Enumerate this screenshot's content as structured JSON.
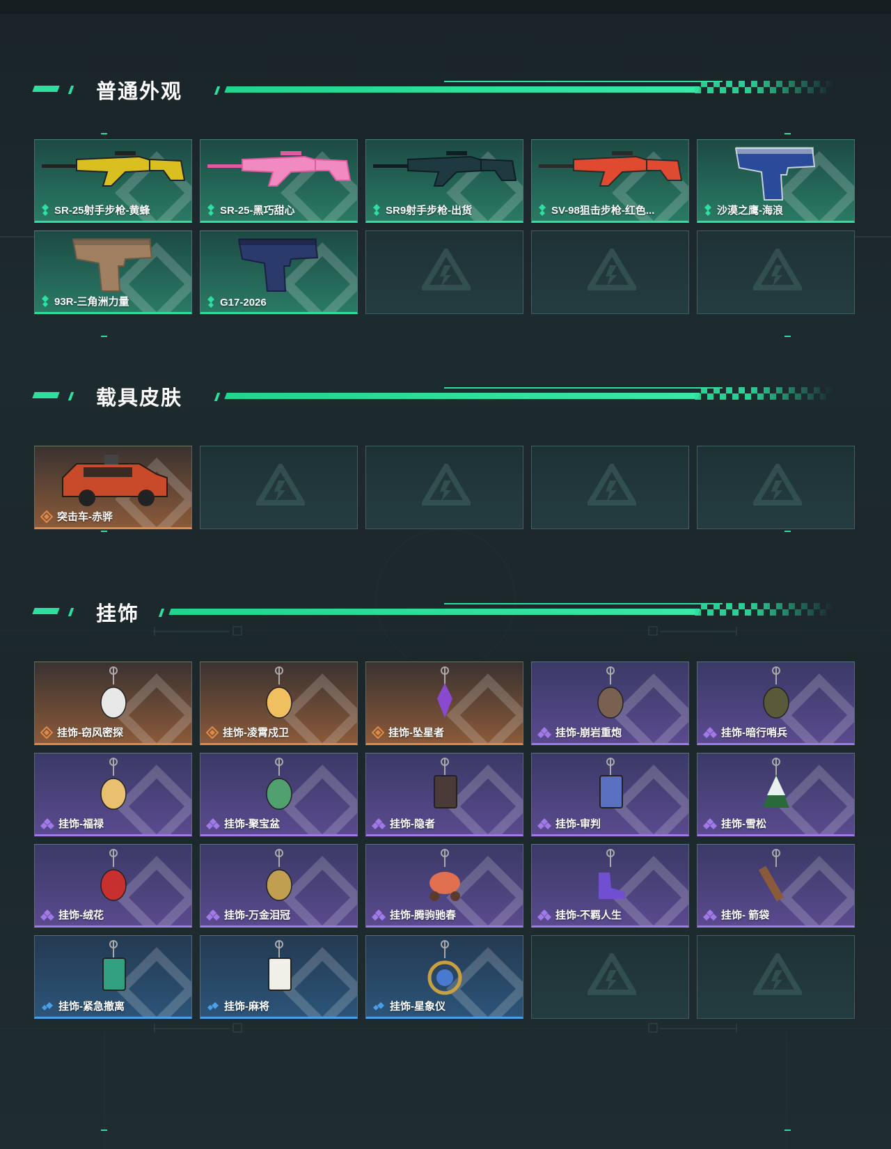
{
  "sections": {
    "skins": {
      "title": "普通外观",
      "items": [
        {
          "name": "SR-25射手步枪-黄蜂",
          "rarity": "green",
          "icon": "rifle-yellow"
        },
        {
          "name": "SR-25-黑巧甜心",
          "rarity": "green",
          "icon": "rifle-pink"
        },
        {
          "name": "SR9射手步枪-出货",
          "rarity": "green",
          "icon": "rifle-teal"
        },
        {
          "name": "SV-98狙击步枪-红色...",
          "rarity": "green",
          "icon": "sniper-red"
        },
        {
          "name": "沙漠之鹰-海浪",
          "rarity": "green",
          "icon": "pistol-blue"
        },
        {
          "name": "93R-三角洲力量",
          "rarity": "green",
          "icon": "pistol-tan"
        },
        {
          "name": "G17-2026",
          "rarity": "green",
          "icon": "pistol-navy"
        }
      ]
    },
    "vehicles": {
      "title": "载具皮肤",
      "items": [
        {
          "name": "突击车-赤骅",
          "rarity": "orange",
          "icon": "vehicle-red"
        }
      ]
    },
    "charms": {
      "title": "挂饰",
      "items": [
        {
          "name": "挂饰-窃风密探",
          "rarity": "orange",
          "icon": "charm-rabbit"
        },
        {
          "name": "挂饰-凌霄戍卫",
          "rarity": "orange",
          "icon": "charm-bird"
        },
        {
          "name": "挂饰-坠星者",
          "rarity": "orange",
          "icon": "charm-crystal"
        },
        {
          "name": "挂饰-崩岩重炮",
          "rarity": "purple",
          "icon": "charm-figure"
        },
        {
          "name": "挂饰-暗行哨兵",
          "rarity": "purple",
          "icon": "charm-soldier"
        },
        {
          "name": "挂饰-福禄",
          "rarity": "purple",
          "icon": "charm-gourd"
        },
        {
          "name": "挂饰-聚宝盆",
          "rarity": "purple",
          "icon": "charm-bowl"
        },
        {
          "name": "挂饰-隐者",
          "rarity": "purple",
          "icon": "charm-card-dark"
        },
        {
          "name": "挂饰-审判",
          "rarity": "purple",
          "icon": "charm-card-blue"
        },
        {
          "name": "挂饰-雪松",
          "rarity": "purple",
          "icon": "charm-tree"
        },
        {
          "name": "挂饰-绒花",
          "rarity": "purple",
          "icon": "charm-flower"
        },
        {
          "name": "挂饰-万金泪冠",
          "rarity": "purple",
          "icon": "charm-egg"
        },
        {
          "name": "挂饰-腾驹驰春",
          "rarity": "purple",
          "icon": "charm-carriage"
        },
        {
          "name": "挂饰-不羁人生",
          "rarity": "purple",
          "icon": "charm-shoe"
        },
        {
          "name": "挂饰- 箭袋",
          "rarity": "purple",
          "icon": "charm-quiver"
        },
        {
          "name": "挂饰-紧急撤离",
          "rarity": "blue",
          "icon": "charm-sign"
        },
        {
          "name": "挂饰-麻将",
          "rarity": "blue",
          "icon": "charm-mahjong"
        },
        {
          "name": "挂饰-星象仪",
          "rarity": "blue",
          "icon": "charm-orb"
        }
      ]
    }
  },
  "colors": {
    "accent": "#2ee0a0",
    "green": "#2ee0a0",
    "orange": "#e08a4a",
    "purple": "#a27ae8",
    "blue": "#4aa0e8"
  }
}
